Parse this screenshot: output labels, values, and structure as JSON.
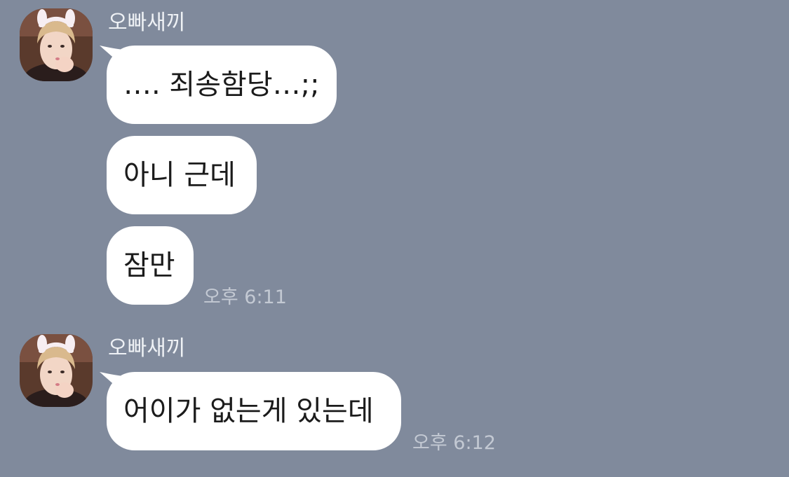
{
  "colors": {
    "background": "#808a9c",
    "bubble": "#ffffff",
    "sender_name": "#eef1f5",
    "timestamp": "#c3c9d3"
  },
  "groups": [
    {
      "sender": "오빠새끼",
      "avatar_icon": "profile-photo",
      "messages": [
        "…. 죄송함당…;;",
        "아니 근데",
        "잠만"
      ],
      "time": "오후 6:11"
    },
    {
      "sender": "오빠새끼",
      "avatar_icon": "profile-photo",
      "messages": [
        "어이가 없는게 있는데"
      ],
      "time": "오후 6:12"
    }
  ]
}
